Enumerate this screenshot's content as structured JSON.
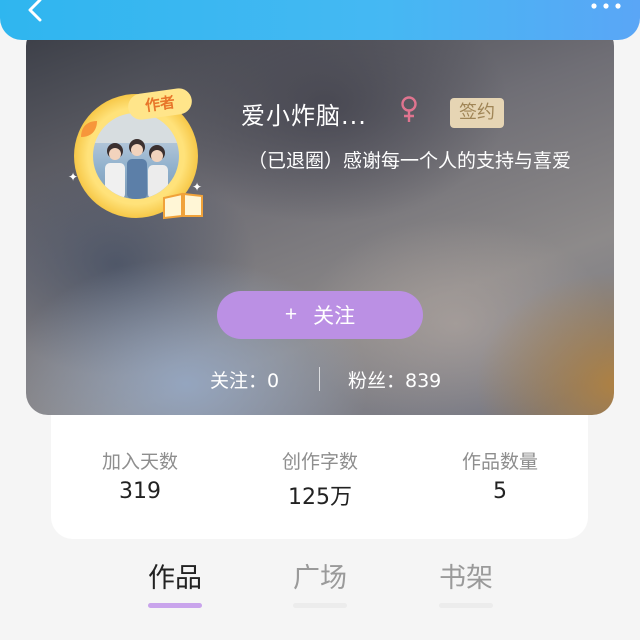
{
  "header": {
    "back_icon": "chevron-left-icon",
    "more_icon": "more-dots-icon",
    "bar_color": "#45b8f3"
  },
  "profile": {
    "author_badge": "作者",
    "name": "爱小炸脑...",
    "gender_icon": "female-icon",
    "gender_color": "#e0748f",
    "sign_badge": "签约",
    "bio": "（已退圈）感谢每一个人的支持与喜爱",
    "follow_plus": "+",
    "follow_label": "关注",
    "follow_color": "#bb90e4",
    "following_label": "关注：0",
    "fans_label": "粉丝：839"
  },
  "stats": [
    {
      "label": "加入天数",
      "value": "319"
    },
    {
      "label": "创作字数",
      "value": "125万"
    },
    {
      "label": "作品数量",
      "value": "5"
    }
  ],
  "tabs": [
    {
      "label": "作品",
      "active": true
    },
    {
      "label": "广场",
      "active": false
    },
    {
      "label": "书架",
      "active": false
    }
  ],
  "accent_color": "#c9a4ec"
}
